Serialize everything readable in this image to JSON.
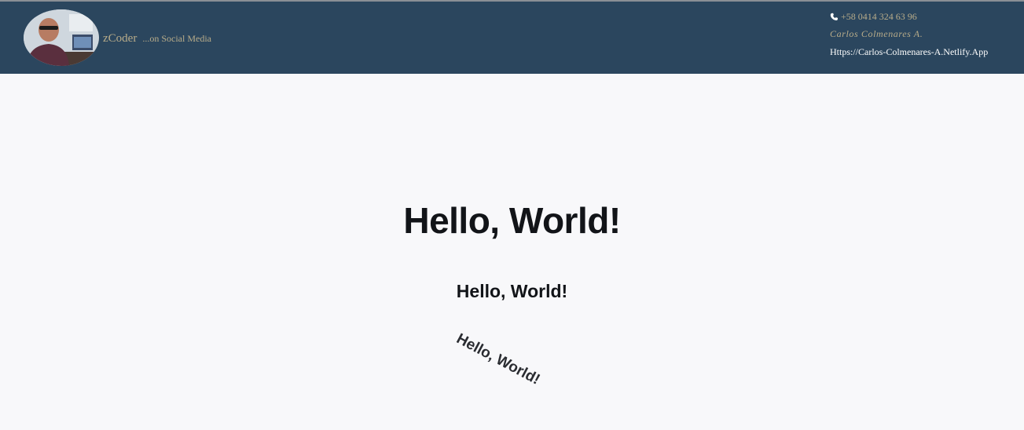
{
  "header": {
    "brand_name": "zCoder",
    "brand_tagline": "...on Social Media",
    "phone": "+58 0414 324 63 96",
    "owner": "Carlos Colmenares A.",
    "website": "Https://Carlos-Colmenares-A.Netlify.App",
    "phone_icon": "phone-icon",
    "colors": {
      "header_bg": "#2b465e",
      "brand_text": "#b8ac8a",
      "link_text": "#ffffff"
    }
  },
  "main": {
    "heading_large": "Hello, World!",
    "heading_medium": "Hello, World!",
    "heading_rotated": "Hello, World!"
  }
}
